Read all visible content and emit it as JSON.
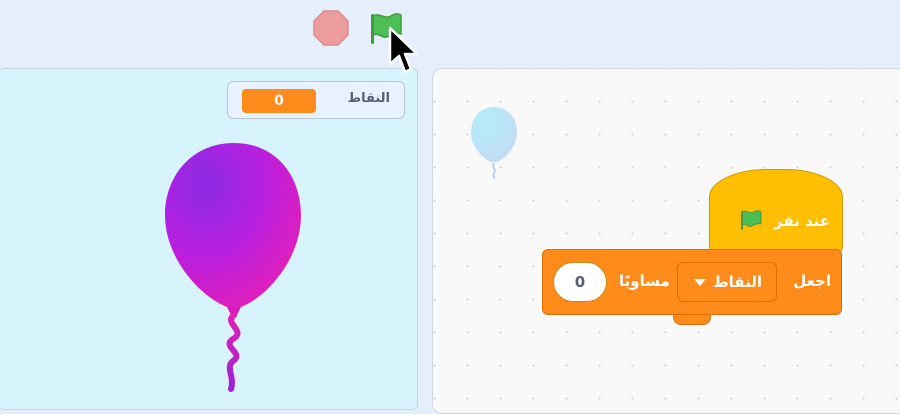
{
  "stage": {
    "monitor": {
      "label": "النقاط",
      "value": "0"
    }
  },
  "script": {
    "hat_block": {
      "text": "عند نقر"
    },
    "set_block": {
      "label": "اجعل",
      "variable": "النقاط",
      "to_text": "مساويًا",
      "value": "0"
    }
  },
  "icons": {
    "stop": "stop-icon",
    "go": "green-flag-icon",
    "cursor": "mouse-cursor-icon",
    "hat_flag": "green-flag-icon",
    "caret": "caret-down-icon"
  },
  "colors": {
    "stage_bg": "#d7f3fb",
    "monitor_value_bg": "#ff8c1a",
    "events_block": "#ffbf00",
    "variables_block": "#ff8c1a",
    "flag": "#4cbf56",
    "stop": "#ec9c9c"
  }
}
